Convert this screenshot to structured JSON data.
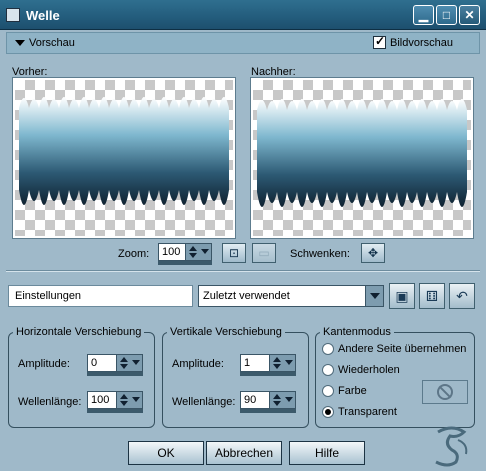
{
  "window": {
    "title": "Welle",
    "icons": {
      "app": "app-icon",
      "minimize": "minimize-icon",
      "maximize": "maximize-icon",
      "close": "close-icon"
    }
  },
  "preview": {
    "section_label": "Vorschau",
    "checkbox_label": "Bildvorschau",
    "checkbox_checked": true,
    "before_label": "Vorher:",
    "after_label": "Nachher:",
    "zoom_label": "Zoom:",
    "zoom_value": "100",
    "pan_label": "Schwenken:"
  },
  "settings": {
    "label": "Einstellungen",
    "preset_value": "Zuletzt verwendet"
  },
  "horizontal": {
    "legend": "Horizontale Verschiebung",
    "amplitude_label": "Amplitude:",
    "amplitude_value": "0",
    "wavelength_label": "Wellenlänge:",
    "wavelength_value": "100"
  },
  "vertical": {
    "legend": "Vertikale Verschiebung",
    "amplitude_label": "Amplitude:",
    "amplitude_value": "1",
    "wavelength_label": "Wellenlänge:",
    "wavelength_value": "90"
  },
  "edge_mode": {
    "legend": "Kantenmodus",
    "options": [
      "Andere Seite übernehmen",
      "Wiederholen",
      "Farbe",
      "Transparent"
    ],
    "selected": "Transparent"
  },
  "buttons": {
    "ok": "OK",
    "cancel": "Abbrechen",
    "help": "Hilfe"
  },
  "colors": {
    "title_bar": "#235c7c",
    "dialog_bg": "#9fb9c9",
    "wave_dark": "#1d3a4d",
    "wave_light": "#7fb8cf"
  }
}
